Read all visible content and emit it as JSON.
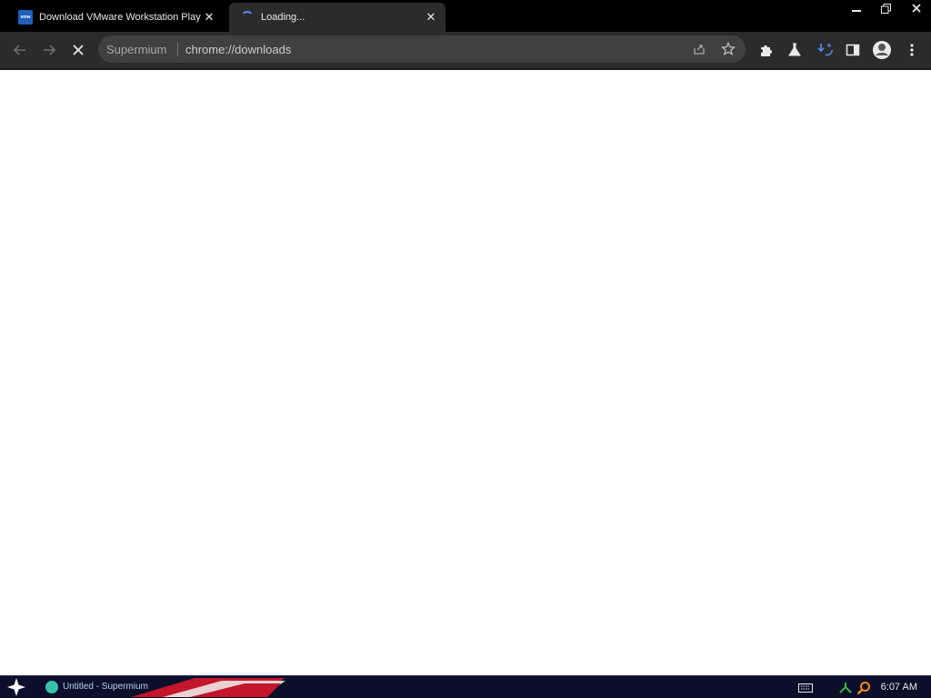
{
  "tabs": [
    {
      "title": "Download VMware Workstation Play",
      "favicon": "vmware-favicon",
      "favicon_text": "vmw",
      "active": false
    },
    {
      "title": "Loading...",
      "favicon": "loading-spinner",
      "active": true
    }
  ],
  "window_controls": {
    "minimize": "minimize-icon",
    "restore": "restore-icon",
    "close": "close-icon"
  },
  "toolbar": {
    "back": "back-arrow-icon",
    "forward": "forward-arrow-icon",
    "stop": "stop-loading-icon"
  },
  "omnibox": {
    "site_label": "Supermium",
    "url": "chrome://downloads"
  },
  "taskbar": {
    "task_label": "Untitled - Supermium",
    "clock": "6:07 AM"
  },
  "colors": {
    "accent": "#5b8def",
    "tab_active": "#2b2b2b",
    "toolbar": "#2b2b2b",
    "taskbar": "#0b0f2a"
  }
}
